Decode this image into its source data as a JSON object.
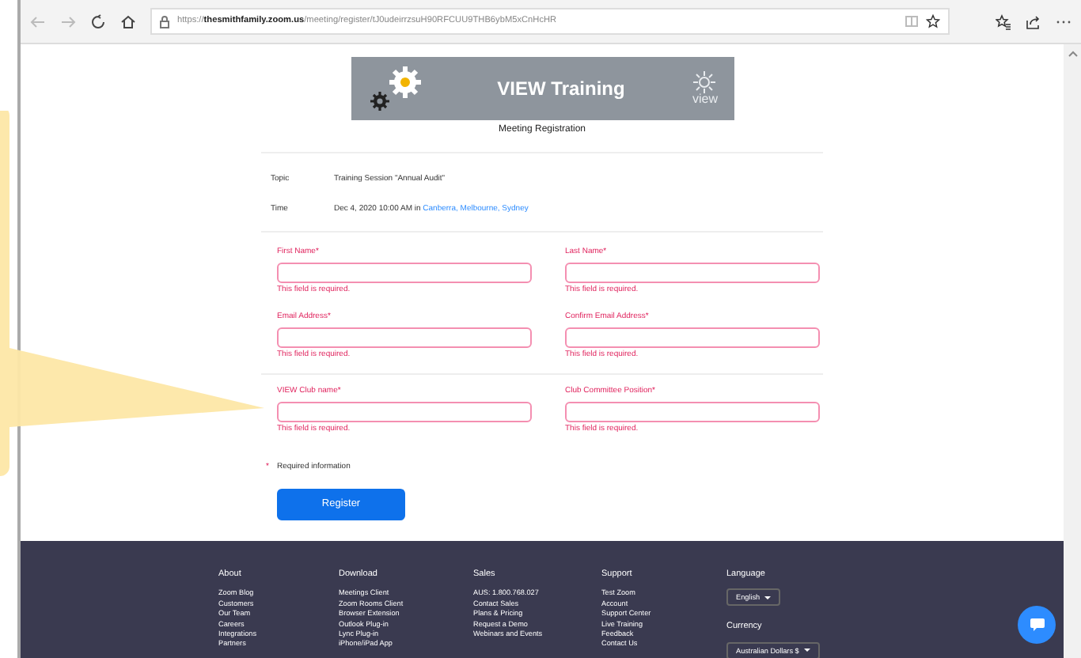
{
  "browser": {
    "url": "https://**thesmithfamily.zoom.us**/meeting/register/tJ0udeirrzsuH90RFCUU9THB6ybM5xCnHcHR"
  },
  "banner": {
    "title": "VIEW Training",
    "logo_text": "view",
    "subtitle": "Meeting Registration"
  },
  "meeting": [
    {
      "label": "Topic",
      "value": "Training Session \"Annual Audit\""
    },
    {
      "label": "Time",
      "value": "Dec 4, 2020 10:00 AM in ",
      "link": "Canberra, Melbourne, Sydney"
    }
  ],
  "field_groups": [
    {
      "rows": [
        [
          {
            "label": "First Name*",
            "error": "This field is required.",
            "invalid": true
          },
          {
            "label": "Last Name*",
            "error": "This field is required.",
            "invalid": true
          }
        ],
        [
          {
            "label": "Email Address*",
            "error": "This field is required.",
            "invalid": true
          },
          {
            "label": "Confirm Email Address*",
            "error": "This field is required.",
            "invalid": true
          }
        ]
      ]
    },
    {
      "rows": [
        [
          {
            "label": "VIEW Club name*",
            "error": "This field is required.",
            "invalid": true
          },
          {
            "label": "Club Committee Position*",
            "error": "This field is required.",
            "invalid": true
          }
        ]
      ]
    }
  ],
  "required_note": {
    "marker": "*",
    "text": "Required information"
  },
  "submit": "Register",
  "footer": {
    "columns": [
      {
        "heading": "About",
        "links": [
          "Zoom Blog",
          "Customers",
          "Our Team",
          "Careers",
          "Integrations",
          "Partners"
        ]
      },
      {
        "heading": "Download",
        "links": [
          "Meetings Client",
          "Zoom Rooms Client",
          "Browser Extension",
          "Outlook Plug-in",
          "Lync Plug-in",
          "iPhone/iPad App"
        ]
      },
      {
        "heading": "Sales",
        "links": [
          "AUS: 1.800.768.027",
          "Contact Sales",
          "Plans & Pricing",
          "Request a Demo",
          "Webinars and Events"
        ]
      },
      {
        "heading": "Support",
        "links": [
          "Test Zoom",
          "Account",
          "Support Center",
          "Live Training",
          "Feedback",
          "Contact Us"
        ]
      }
    ],
    "language": {
      "heading": "Language",
      "value": "English"
    },
    "currency": {
      "heading": "Currency",
      "value": "Australian Dollars $"
    }
  }
}
